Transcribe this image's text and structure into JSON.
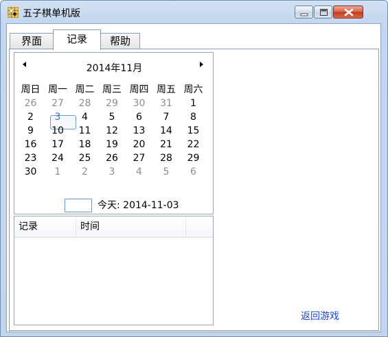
{
  "window": {
    "title": "五子棋单机版"
  },
  "tabs": [
    {
      "label": "界面"
    },
    {
      "label": "记录"
    },
    {
      "label": "帮助"
    }
  ],
  "calendar": {
    "month_label": "2014年11月",
    "weekdays": [
      "周日",
      "周一",
      "周二",
      "周三",
      "周四",
      "周五",
      "周六"
    ],
    "weeks": [
      [
        "26",
        "27",
        "28",
        "29",
        "30",
        "31",
        "1"
      ],
      [
        "2",
        "3",
        "4",
        "5",
        "6",
        "7",
        "8"
      ],
      [
        "9",
        "10",
        "11",
        "12",
        "13",
        "14",
        "15"
      ],
      [
        "16",
        "17",
        "18",
        "19",
        "20",
        "21",
        "22"
      ],
      [
        "23",
        "24",
        "25",
        "26",
        "27",
        "28",
        "29"
      ],
      [
        "30",
        "1",
        "2",
        "3",
        "4",
        "5",
        "6"
      ]
    ],
    "today_label": "今天: 2014-11-03"
  },
  "records": {
    "columns": [
      "记录",
      "时间"
    ]
  },
  "back_link": "返回游戏",
  "colors": {
    "accent": "#1c46c9",
    "selected": "#3a6fb3",
    "other_month": "#8d8d8d"
  }
}
